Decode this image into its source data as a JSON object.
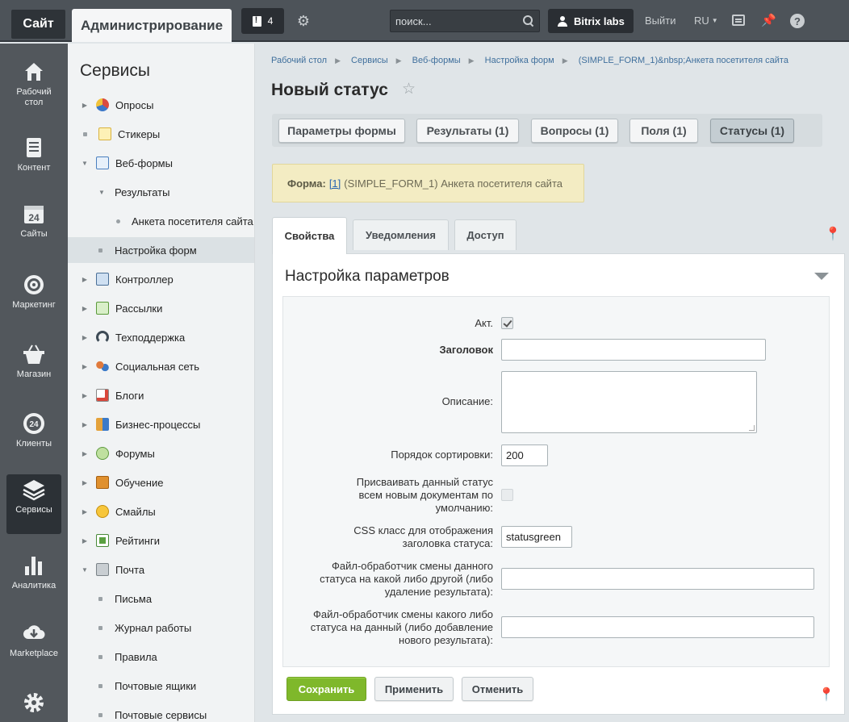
{
  "topbar": {
    "site_label": "Сайт",
    "admin_label": "Администрирование",
    "notifications_count": "4",
    "search_placeholder": "поиск...",
    "user_name": "Bitrix labs",
    "logout_label": "Выйти",
    "lang_label": "RU"
  },
  "leftnav": {
    "items": [
      {
        "label": "Рабочий стол",
        "icon": "home-icon"
      },
      {
        "label": "Контент",
        "icon": "document-icon"
      },
      {
        "label": "Сайты",
        "icon": "calendar-24-icon"
      },
      {
        "label": "Маркетинг",
        "icon": "target-icon"
      },
      {
        "label": "Магазин",
        "icon": "basket-icon"
      },
      {
        "label": "Клиенты",
        "icon": "clients-24-icon"
      },
      {
        "label": "Сервисы",
        "icon": "layers-icon",
        "active": true
      },
      {
        "label": "Аналитика",
        "icon": "bar-chart-icon"
      },
      {
        "label": "Marketplace",
        "icon": "cloud-download-icon"
      },
      {
        "label": "",
        "icon": "gear-icon"
      }
    ]
  },
  "sidebar": {
    "title": "Сервисы",
    "items": [
      {
        "label": "Опросы",
        "type": "arrow-right",
        "icon": "poll-icon"
      },
      {
        "label": "Стикеры",
        "type": "dot",
        "icon": "sticker-icon"
      },
      {
        "label": "Веб-формы",
        "type": "arrow-down",
        "icon": "webform-icon"
      },
      {
        "label": "Результаты",
        "type": "arrow-down"
      },
      {
        "label": "Анкета посетителя сайта",
        "type": "bullet"
      },
      {
        "label": "Настройка форм",
        "type": "dot",
        "selected": true
      },
      {
        "label": "Контроллер",
        "type": "arrow-right",
        "icon": "controller-icon"
      },
      {
        "label": "Рассылки",
        "type": "arrow-right",
        "icon": "mail-icon"
      },
      {
        "label": "Техподдержка",
        "type": "arrow-right",
        "icon": "headset-icon"
      },
      {
        "label": "Социальная сеть",
        "type": "arrow-right",
        "icon": "social-icon"
      },
      {
        "label": "Блоги",
        "type": "arrow-right",
        "icon": "blog-icon"
      },
      {
        "label": "Бизнес-процессы",
        "type": "arrow-right",
        "icon": "bizproc-icon"
      },
      {
        "label": "Форумы",
        "type": "arrow-right",
        "icon": "forum-icon"
      },
      {
        "label": "Обучение",
        "type": "arrow-right",
        "icon": "learning-icon"
      },
      {
        "label": "Смайлы",
        "type": "arrow-right",
        "icon": "smile-icon"
      },
      {
        "label": "Рейтинги",
        "type": "arrow-right",
        "icon": "rating-icon"
      },
      {
        "label": "Почта",
        "type": "arrow-down",
        "icon": "post-icon"
      },
      {
        "label": "Письма",
        "type": "dot"
      },
      {
        "label": "Журнал работы",
        "type": "dot"
      },
      {
        "label": "Правила",
        "type": "dot"
      },
      {
        "label": "Почтовые ящики",
        "type": "dot"
      },
      {
        "label": "Почтовые сервисы",
        "type": "dot"
      }
    ]
  },
  "breadcrumbs": [
    "Рабочий стол",
    "Сервисы",
    "Веб-формы",
    "Настройка форм",
    "(SIMPLE_FORM_1)&nbsp;Анкета посетителя сайта"
  ],
  "page_title": "Новый статус",
  "form_tabs": [
    {
      "label": "Параметры формы"
    },
    {
      "label": "Результаты (1)"
    },
    {
      "label": "Вопросы (1)"
    },
    {
      "label": "Поля (1)"
    },
    {
      "label": "Статусы (1)",
      "active": true
    }
  ],
  "form_note": {
    "label": "Форма:",
    "link": "[1]",
    "text": "(SIMPLE_FORM_1) Анкета посетителя сайта"
  },
  "sub_tabs": [
    {
      "label": "Свойства",
      "active": true
    },
    {
      "label": "Уведомления"
    },
    {
      "label": "Доступ"
    }
  ],
  "panel": {
    "title": "Настройка параметров",
    "fields": {
      "active": {
        "label": "Акт.",
        "checked": true
      },
      "title": {
        "label": "Заголовок",
        "value": ""
      },
      "description": {
        "label": "Описание:",
        "value": ""
      },
      "sort": {
        "label": "Порядок сортировки:",
        "value": "200"
      },
      "default": {
        "label": "Присваивать данный статус всем новым документам по умолчанию:",
        "checked": false
      },
      "css": {
        "label": "CSS класс для отображения заголовка статуса:",
        "value": "statusgreen"
      },
      "handler_out": {
        "label": "Файл-обработчик смены данного статуса на какой либо другой (либо удаление результата):",
        "value": ""
      },
      "handler_in": {
        "label": "Файл-обработчик смены какого либо статуса на данный (либо добавление нового результата):",
        "value": ""
      }
    }
  },
  "buttons": {
    "save": "Сохранить",
    "apply": "Применить",
    "cancel": "Отменить"
  },
  "colors": {
    "topbar": "#4d5359",
    "save_button": "#7fb82b",
    "link": "#3f6f9c",
    "note_bg": "#f3ecc3"
  }
}
